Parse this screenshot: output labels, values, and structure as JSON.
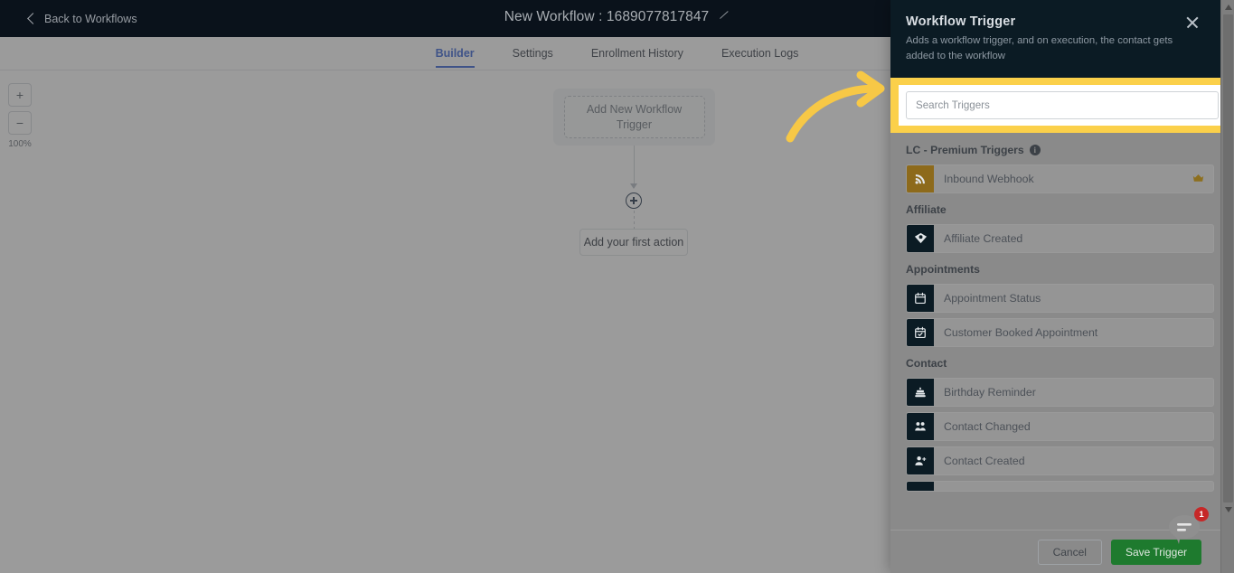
{
  "topbar": {
    "back_label": "Back to Workflows",
    "back_icon": "chevron-left-icon",
    "title": "New Workflow : 1689077817847",
    "edit_icon": "pencil-icon"
  },
  "tabs": [
    {
      "label": "Builder",
      "active": true
    },
    {
      "label": "Settings",
      "active": false
    },
    {
      "label": "Enrollment History",
      "active": false
    },
    {
      "label": "Execution Logs",
      "active": false
    }
  ],
  "canvas": {
    "zoom_in_label": "+",
    "zoom_out_label": "−",
    "zoom_level": "100%",
    "trigger_card_label": "Add New Workflow Trigger",
    "add_node_icon": "plus-circle-icon",
    "first_action_label": "Add your first action"
  },
  "panel": {
    "title": "Workflow Trigger",
    "description": "Adds a workflow trigger, and on execution, the contact gets added to the workflow",
    "close_icon": "close-icon",
    "search": {
      "placeholder": "Search Triggers",
      "value": "",
      "highlight_color": "#fbd04a"
    },
    "groups": [
      {
        "title": "LC - Premium Triggers",
        "has_info_icon": true,
        "info_icon": "info-icon",
        "items": [
          {
            "label": "Inbound Webhook",
            "icon": "rss-webhook-icon",
            "icon_style": "gold",
            "premium": true,
            "premium_icon": "crown-icon"
          }
        ]
      },
      {
        "title": "Affiliate",
        "has_info_icon": false,
        "items": [
          {
            "label": "Affiliate Created",
            "icon": "gem-icon",
            "icon_style": "dark",
            "premium": false
          }
        ]
      },
      {
        "title": "Appointments",
        "has_info_icon": false,
        "items": [
          {
            "label": "Appointment Status",
            "icon": "calendar-icon",
            "icon_style": "dark",
            "premium": false
          },
          {
            "label": "Customer Booked Appointment",
            "icon": "calendar-check-icon",
            "icon_style": "dark",
            "premium": false
          }
        ]
      },
      {
        "title": "Contact",
        "has_info_icon": false,
        "items": [
          {
            "label": "Birthday Reminder",
            "icon": "cake-icon",
            "icon_style": "dark",
            "premium": false
          },
          {
            "label": "Contact Changed",
            "icon": "users-icon",
            "icon_style": "dark",
            "premium": false
          },
          {
            "label": "Contact Created",
            "icon": "user-plus-icon",
            "icon_style": "dark",
            "premium": false
          }
        ]
      }
    ],
    "footer": {
      "cancel_label": "Cancel",
      "save_label": "Save Trigger",
      "save_color": "#1e7a2e"
    },
    "scrollbar": {
      "up_icon": "caret-up-icon",
      "down_icon": "caret-down-icon"
    }
  },
  "annotation": {
    "arrow_icon": "curved-arrow-icon",
    "arrow_color": "#f7c846"
  },
  "chat_widget": {
    "icon": "chat-bubble-icon",
    "badge_count": "1",
    "badge_color": "#c62828"
  }
}
